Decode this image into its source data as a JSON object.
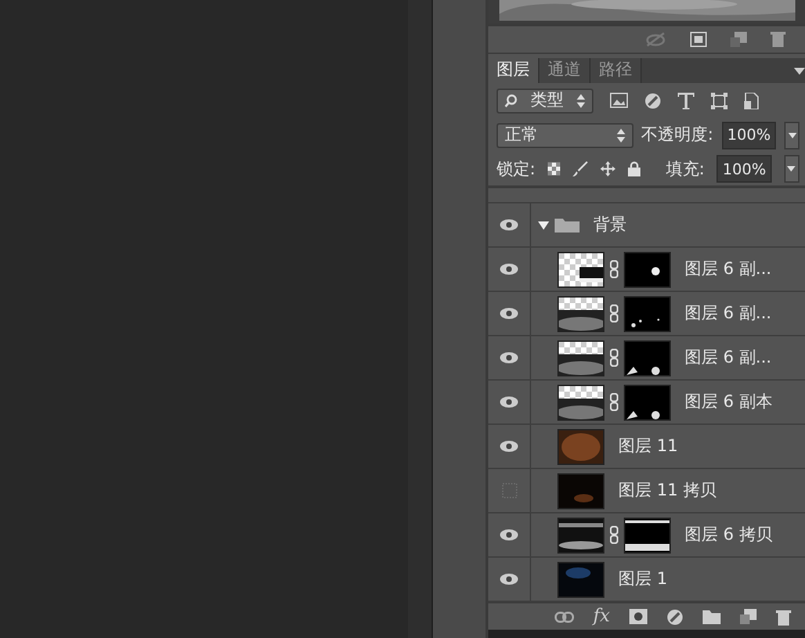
{
  "layers_panel": {
    "tabs": [
      {
        "label": "图层",
        "selected": true
      },
      {
        "label": "通道",
        "selected": false
      },
      {
        "label": "路径",
        "selected": false
      }
    ],
    "filter": {
      "label": "类型"
    },
    "blend_mode": {
      "value": "正常"
    },
    "opacity": {
      "label": "不透明度:",
      "value": "100%"
    },
    "lock": {
      "label": "锁定:"
    },
    "fill": {
      "label": "填充:",
      "value": "100%"
    },
    "layers": [
      {
        "name": "背景",
        "visible": true,
        "expanded": true,
        "children": [
          {
            "name": "图层 6 副...",
            "visible": true,
            "mask": true
          },
          {
            "name": "图层 6 副...",
            "visible": true,
            "mask": true
          },
          {
            "name": "图层 6 副...",
            "visible": true,
            "mask": true
          },
          {
            "name": "图层 6 副本",
            "visible": true,
            "mask": true
          },
          {
            "name": "图层 11",
            "visible": true,
            "mask": false
          },
          {
            "name": "图层 11 拷贝",
            "visible": false,
            "mask": false
          },
          {
            "name": "图层 6 拷贝",
            "visible": true,
            "mask": true
          },
          {
            "name": "图层 1",
            "visible": true,
            "mask": false
          }
        ]
      }
    ],
    "footer": {
      "fx_label": "fx"
    }
  }
}
